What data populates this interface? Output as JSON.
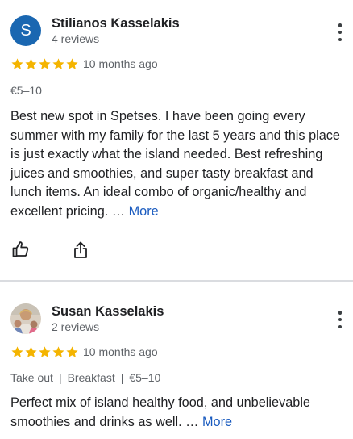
{
  "reviews": [
    {
      "avatar_letter": "S",
      "avatar_color": "#1a67b1",
      "name": "Stilianos Kasselakis",
      "review_count": "4 reviews",
      "rating": 5,
      "time_ago": "10 months ago",
      "meta": [
        "€5–10"
      ],
      "text": "Best new spot in Spetses. I have been going every summer with my family for the last 5 years and this place is just exactly what the island needed. Best refreshing juices and smoothies, and super tasty breakfast and lunch items. An ideal combo of organic/healthy and excellent pricing. …",
      "more_label": "More",
      "actions": [
        "thumbs-up-icon",
        "share-icon"
      ]
    },
    {
      "avatar_icon": "profile-photo",
      "name": "Susan Kasselakis",
      "review_count": "2 reviews",
      "rating": 5,
      "time_ago": "10 months ago",
      "meta": [
        "Take out",
        "Breakfast",
        "€5–10"
      ],
      "text": "Perfect mix of island healthy food, and unbelievable smoothies and drinks as well. …",
      "more_label": "More"
    }
  ],
  "colors": {
    "star": "#f4b400",
    "link": "#1a5bbf",
    "secondary_text": "#5f6368"
  }
}
